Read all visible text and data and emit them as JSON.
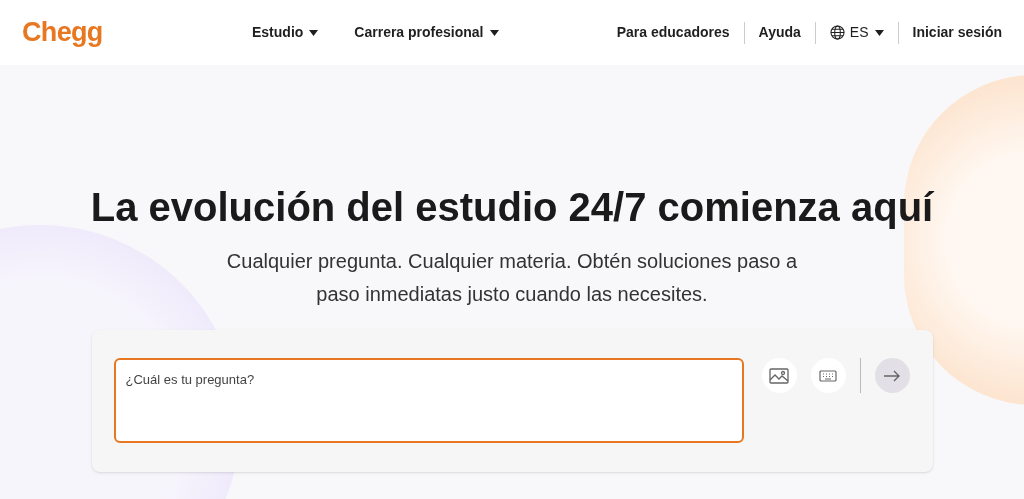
{
  "header": {
    "logo": "Chegg",
    "nav": [
      {
        "label": "Estudio",
        "dropdown": true
      },
      {
        "label": "Carrera profesional",
        "dropdown": true
      }
    ],
    "links": [
      "Para educadores",
      "Ayuda"
    ],
    "language": "ES",
    "sign_in": "Iniciar sesión"
  },
  "hero": {
    "title": "La evolución del estudio 24/7 comienza aquí",
    "subtitle": "Cualquier pregunta. Cualquier materia. Obtén soluciones paso a paso inmediatas justo cuando las necesites."
  },
  "search": {
    "placeholder": "¿Cuál es tu pregunta?"
  }
}
